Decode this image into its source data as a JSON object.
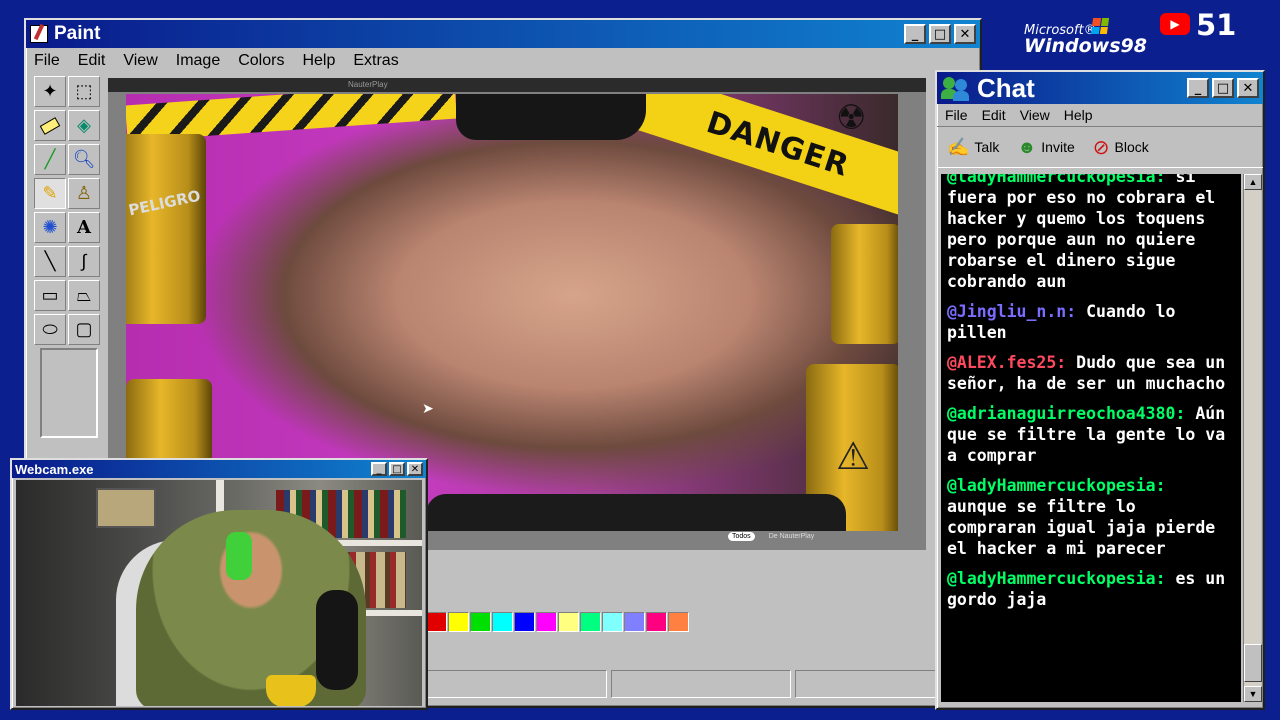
{
  "paint": {
    "title": "Paint",
    "menu": [
      "File",
      "Edit",
      "View",
      "Image",
      "Colors",
      "Help",
      "Extras"
    ],
    "tools": [
      "free-select",
      "rect-select",
      "eraser",
      "fill",
      "color-picker",
      "magnifier",
      "pencil",
      "brush",
      "airbrush",
      "text",
      "line",
      "curve",
      "rectangle",
      "polygon",
      "ellipse",
      "rounded-rect"
    ],
    "canvas": {
      "embedded_app_name": "NauterPlay",
      "tab_all": "Todos",
      "tab_source": "De NauterPlay",
      "danger_text": "DANGER",
      "barrel_text": "PELIGRO"
    },
    "palette": [
      "#e00000",
      "#ffff00",
      "#00e000",
      "#00ffff",
      "#0000ff",
      "#ff00ff",
      "#ffff80",
      "#00ff80",
      "#80ffff",
      "#8080ff",
      "#ff0080",
      "#ff8040"
    ]
  },
  "branding": {
    "microsoft": "Microsoft®",
    "windows": "Windows98",
    "youtube_count": "51"
  },
  "chat": {
    "title": "Chat",
    "menu": [
      "File",
      "Edit",
      "View",
      "Help"
    ],
    "toolbar": {
      "talk": "Talk",
      "invite": "Invite",
      "block": "Block"
    },
    "messages": [
      {
        "user": "@ladyHammercuckopesia:",
        "text": "si fuera por eso no cobrara el hacker y quemo los toquens pero porque aun no quiere robarse el dinero sigue cobrando aun",
        "color": "#00ff66"
      },
      {
        "user": "@Jingliu_n.n:",
        "text": "Cuando lo pillen",
        "color": "#7a6cff"
      },
      {
        "user": "@ALEX.fes25:",
        "text": "Dudo que sea un señor, ha de ser un muchacho",
        "color": "#ff4a5e"
      },
      {
        "user": "@adrianaguirreochoa4380:",
        "text": "Aún que se filtre la gente lo va a comprar",
        "color": "#00ff66"
      },
      {
        "user": "@ladyHammercuckopesia:",
        "text": "aunque se filtre lo compraran igual jaja pierde el hacker a mi parecer",
        "color": "#00ff66"
      },
      {
        "user": "@ladyHammercuckopesia:",
        "text": "es un gordo jaja",
        "color": "#00ff66"
      }
    ]
  },
  "webcam": {
    "title": "Webcam.exe"
  }
}
